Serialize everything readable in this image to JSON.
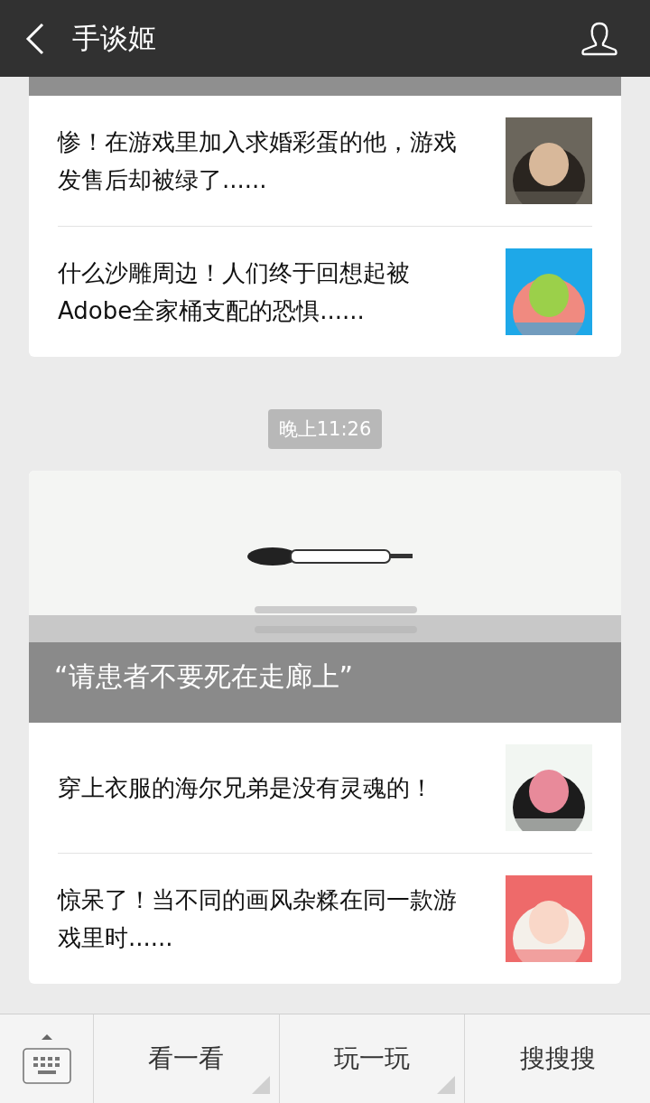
{
  "header": {
    "title": "手谈姬"
  },
  "messages": [
    {
      "cover": {
        "kind": "picture"
      },
      "articles": [
        {
          "title": "惨！在游戏里加入求婚彩蛋的他，游戏发售后却被绿了......"
        },
        {
          "title": "什么沙雕周边！人们终于回想起被Adobe全家桶支配的恐惧......"
        }
      ]
    },
    {
      "time": "晚上11:26",
      "cover": {
        "kind": "picture",
        "title": "“请患者不要死在走廊上”"
      },
      "articles": [
        {
          "title": "穿上衣服的海尔兄弟是没有灵魂的！"
        },
        {
          "title": "惊呆了！当不同的画风杂糅在同一款游戏里时......"
        }
      ]
    }
  ],
  "menu": [
    {
      "label": "看一看",
      "submenu": true
    },
    {
      "label": "玩一玩",
      "submenu": true
    },
    {
      "label": "搜搜搜",
      "submenu": false
    }
  ]
}
